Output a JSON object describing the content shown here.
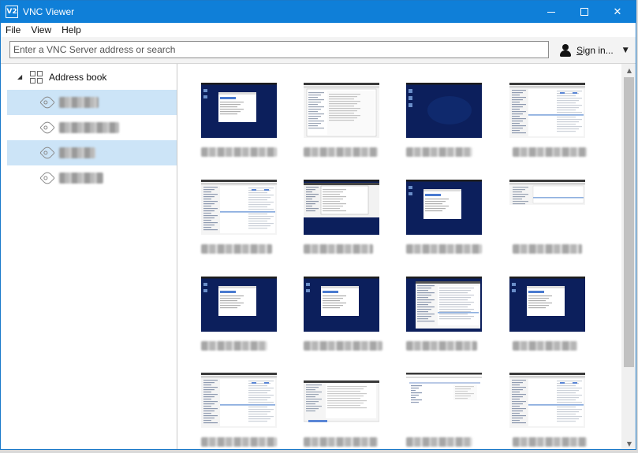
{
  "window": {
    "title": "VNC Viewer",
    "app_icon_text": "V2"
  },
  "menu": [
    "File",
    "View",
    "Help"
  ],
  "toolbar": {
    "search_placeholder": "Enter a VNC Server address or search",
    "signin_label": "Sign in..."
  },
  "sidebar": {
    "header": "Address book",
    "items": [
      "▓▓ ▓▓▓▓",
      "▓▓▓▓▓▓-▓▓",
      "▓▓-▓▓▓",
      "▓▓▓▓▓▓"
    ]
  },
  "thumbnails": [
    {
      "label": "▓▓▓▓▓▓▓▓▓▓▓▓▓▓",
      "screen": "dark-dialog"
    },
    {
      "label": "▓▓▓▓▓▓▓▓▓▓▓▓▓",
      "screen": "filemanager"
    },
    {
      "label": "▓▓▓▓▓▓▓▓▓▓▓▓",
      "screen": "dark-desktop"
    },
    {
      "label": "▓▓▓▓▓▓▓▓▓▓▓",
      "screen": "browser"
    },
    {
      "label": "▓▓▓▓▓▓▓▓▓▓▓▓▓",
      "screen": "browser"
    },
    {
      "label": "▓▓▓▓▓▓▓▓▓▓▓▓▓▓",
      "screen": "dark-filemanager"
    },
    {
      "label": "▓▓▓▓▓▓▓▓▓▓▓▓▓",
      "screen": "dark-dialog"
    },
    {
      "label": "▓▓▓▓▓▓▓▓▓▓▓▓▓▓",
      "screen": "browser-short"
    },
    {
      "label": "▓▓▓▓▓▓▓▓▓▓▓▓",
      "screen": "dark-dialog"
    },
    {
      "label": "▓▓▓▓▓▓▓▓▓▓▓▓▓",
      "screen": "dark-dialog"
    },
    {
      "label": "▓▓▓▓▓▓▓▓▓▓▓▓▓▓▓",
      "screen": "dark-browser"
    },
    {
      "label": "▓▓▓▓▓▓▓▓▓▓",
      "screen": "dark-dialog"
    },
    {
      "label": "▓▓▓▓▓▓▓▓▓▓▓▓▓▓▓",
      "screen": "browser"
    },
    {
      "label": "▓▓▓▓▓▓▓▓▓▓▓▓▓▓▓",
      "screen": "filemanager-low"
    },
    {
      "label": "▓▓▓▓▓▓▓▓▓▓▓▓▓▓▓",
      "screen": "browser-light"
    },
    {
      "label": "▓▓▓▓▓▓▓▓▓▓▓▓▓",
      "screen": "browser"
    }
  ],
  "colors": {
    "titlebar": "#0f7fd8",
    "selected_row": "#cce4f7",
    "desktop_blue": "#0c1f5c"
  }
}
